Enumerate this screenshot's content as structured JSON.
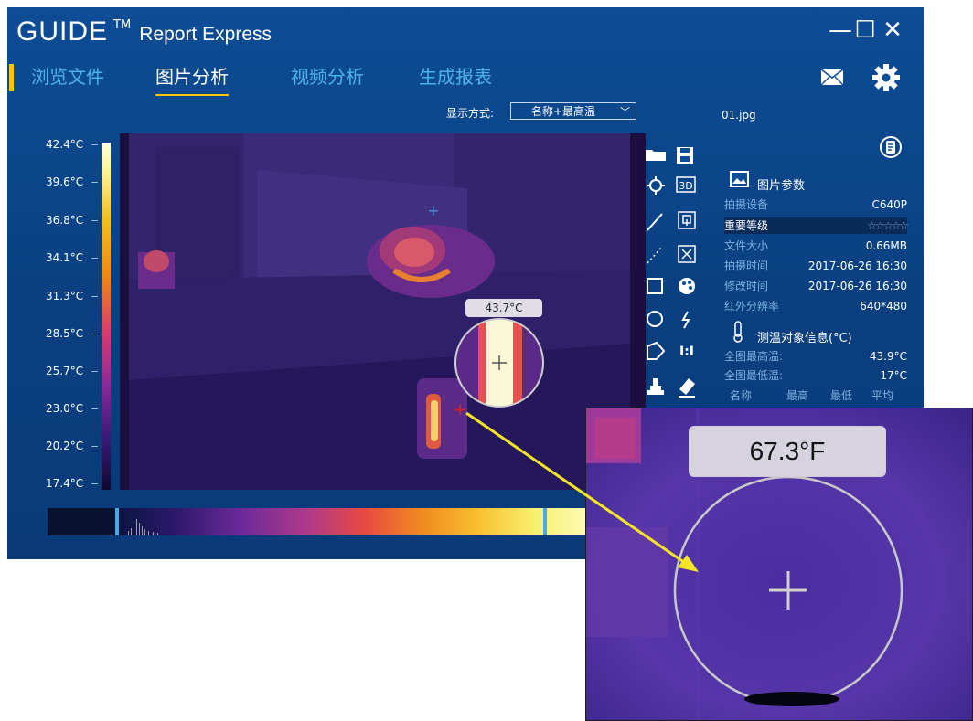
{
  "app": {
    "brand": "GUIDE",
    "trademark": "TM",
    "product": "Report Express",
    "window_controls": {
      "minimize": "—",
      "maximize": "☐",
      "close": "✕"
    }
  },
  "nav": {
    "items": [
      {
        "label": "浏览文件",
        "active": false
      },
      {
        "label": "图片分析",
        "active": true
      },
      {
        "label": "视频分析",
        "active": false
      },
      {
        "label": "生成报表",
        "active": false
      }
    ],
    "icons": [
      "mail-icon",
      "gear-icon"
    ]
  },
  "display_mode": {
    "label": "显示方式:",
    "value": "名称+最高温"
  },
  "file": {
    "name": "01.jpg"
  },
  "scale": {
    "labels": [
      "42.4°C",
      "39.6°C",
      "36.8°C",
      "34.1°C",
      "31.3°C",
      "28.5°C",
      "25.7°C",
      "23.0°C",
      "20.2°C",
      "17.4°C"
    ]
  },
  "thermal": {
    "spot_reading": "43.7°C"
  },
  "toolbar": {
    "tools": [
      "open-folder-icon",
      "save-icon",
      "spot-icon",
      "3d-icon",
      "line-icon",
      "copy-icon",
      "polyline-icon",
      "close-box-icon",
      "rectangle-icon",
      "palette-icon",
      "circle-icon",
      "lightning-icon",
      "polygon-icon",
      "ratio-icon",
      "stamp-icon",
      "eraser-icon"
    ]
  },
  "panel": {
    "list_icon": "list-icon",
    "image_params_title": "图片参数",
    "params": [
      {
        "key": "拍摄设备",
        "value": "C640P"
      },
      {
        "key": "重要等级",
        "value": "☆☆☆☆☆"
      },
      {
        "key": "文件大小",
        "value": "0.66MB"
      },
      {
        "key": "拍摄时间",
        "value": "2017-06-26 16:30"
      },
      {
        "key": "修改时间",
        "value": "2017-06-26 16:30"
      },
      {
        "key": "红外分辨率",
        "value": "640*480"
      }
    ],
    "measure_title": "测温对象信息(°C)",
    "measure": [
      {
        "key": "全图最高温:",
        "value": "43.9°C"
      },
      {
        "key": "全图最低温:",
        "value": "17°C"
      }
    ],
    "table_headers": [
      "名称",
      "最高",
      "最低",
      "平均"
    ]
  },
  "magnifier": {
    "reading": "67.3°F"
  },
  "colors": {
    "window_bg": "#0d4d95",
    "accent": "#f7c800",
    "nav_inactive": "#4cb3e8",
    "arrow": "#f4e526"
  }
}
